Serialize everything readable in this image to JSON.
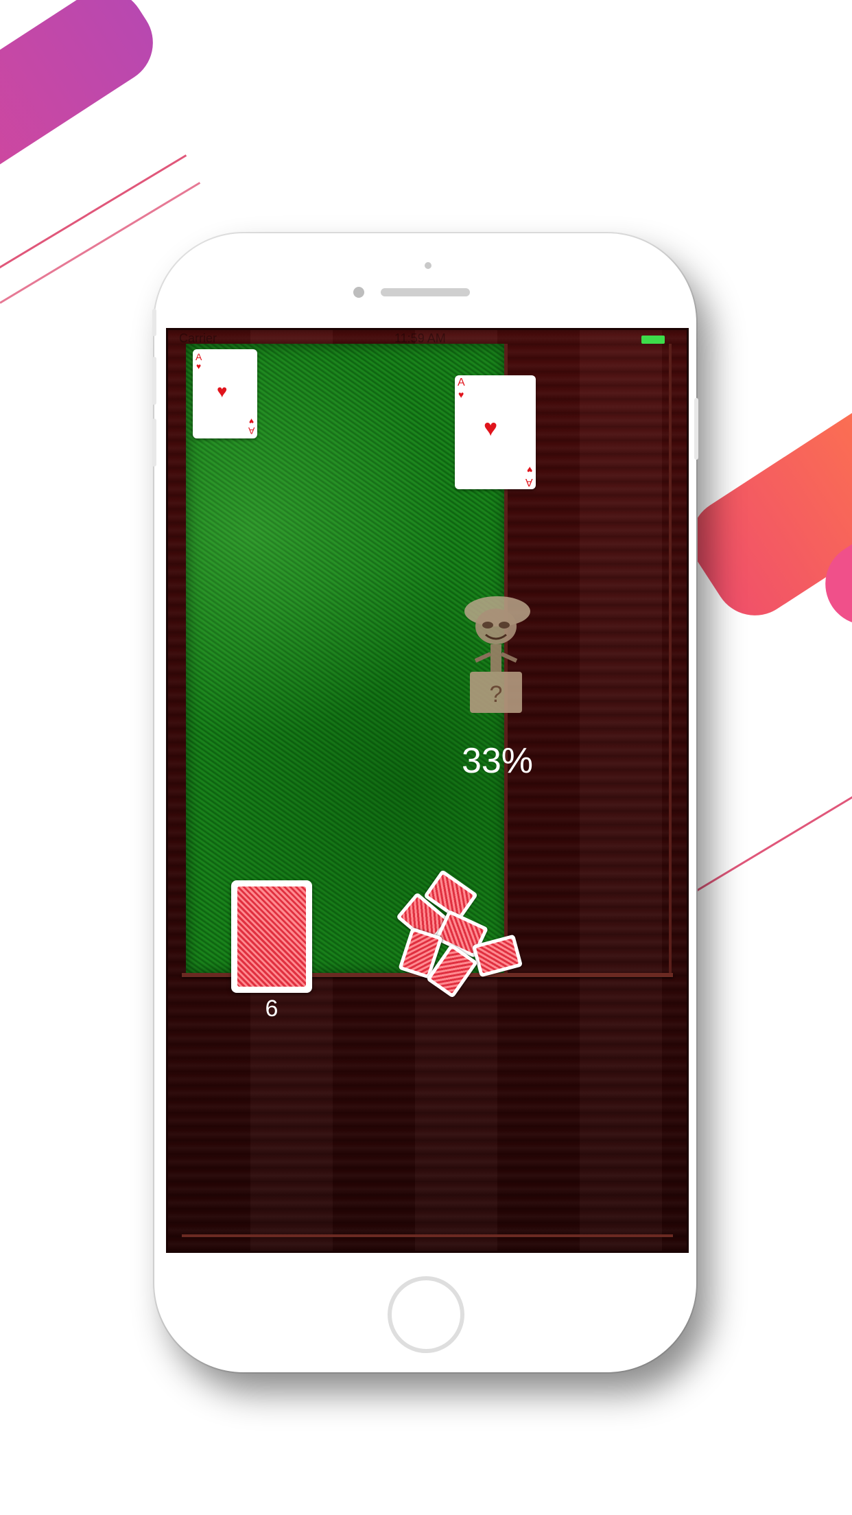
{
  "status_bar": {
    "carrier": "Carrier",
    "time": "11:59 AM"
  },
  "table": {
    "player_card": {
      "rank": "A",
      "suit": "heart"
    },
    "opponent_card": {
      "rank": "A",
      "suit": "heart"
    },
    "opponent_avatar": "jester-in-box-icon",
    "win_chance": "33%",
    "deck_count": "6"
  },
  "colors": {
    "felt": "#157a18",
    "wood": "#3b0808",
    "card_red": "#e0141c",
    "battery": "#3ddc4a"
  }
}
